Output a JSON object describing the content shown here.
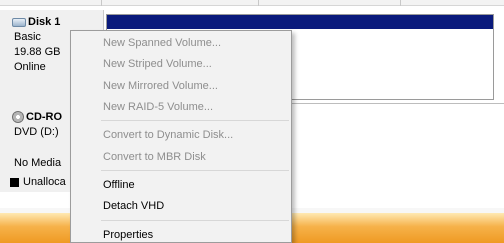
{
  "disk": {
    "title": "Disk 1",
    "type": "Basic",
    "size": "19.88 GB",
    "status": "Online",
    "volume_color": "#0a1a7c"
  },
  "cdrom": {
    "title": "CD-RO",
    "drive": "DVD (D:)",
    "media": "No Media",
    "legend_label": "Unalloca"
  },
  "context_menu": {
    "items": [
      {
        "label": "New Spanned Volume...",
        "enabled": false
      },
      {
        "label": "New Striped Volume...",
        "enabled": false
      },
      {
        "label": "New Mirrored Volume...",
        "enabled": false
      },
      {
        "label": "New RAID-5 Volume...",
        "enabled": false
      },
      {
        "label": "Convert to Dynamic Disk...",
        "enabled": false
      },
      {
        "label": "Convert to MBR Disk",
        "enabled": false
      },
      {
        "label": "Offline",
        "enabled": true
      },
      {
        "label": "Detach VHD",
        "enabled": true
      },
      {
        "label": "Properties",
        "enabled": true
      }
    ]
  },
  "colors": {
    "taskbar": "#ef9a23",
    "menu_background": "#f2f2f2",
    "disabled_text": "#8e8e8e"
  }
}
